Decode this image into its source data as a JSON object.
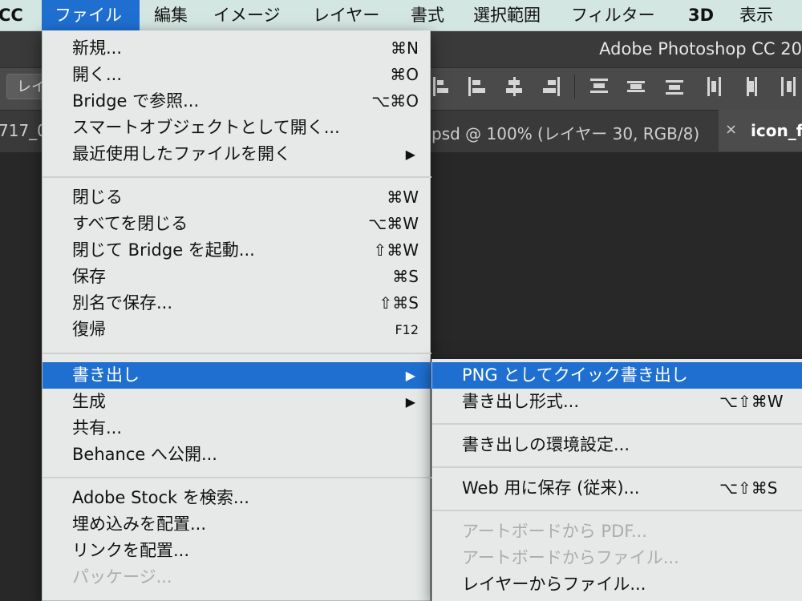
{
  "menubar": {
    "app_name": "CC",
    "items": [
      "ファイル",
      "編集",
      "イメージ",
      "レイヤー",
      "書式",
      "選択範囲",
      "フィルター",
      "3D",
      "表示"
    ]
  },
  "window_title": "Adobe Photoshop CC 20",
  "options_bar": {
    "layer_select_label": "レイヤー"
  },
  "tabs": {
    "left_fragment": "717_0",
    "middle": "psd @ 100% (レイヤー 30, RGB/8)",
    "active": "icon_fo"
  },
  "file_menu": {
    "items": [
      {
        "label": "新規...",
        "shortcut": "⌘N"
      },
      {
        "label": "開く...",
        "shortcut": "⌘O"
      },
      {
        "label": "Bridge で参照...",
        "shortcut": "⌥⌘O"
      },
      {
        "label": "スマートオブジェクトとして開く...",
        "shortcut": ""
      },
      {
        "label": "最近使用したファイルを開く",
        "submenu": true
      },
      {
        "label": "閉じる",
        "shortcut": "⌘W"
      },
      {
        "label": "すべてを閉じる",
        "shortcut": "⌥⌘W"
      },
      {
        "label": "閉じて Bridge を起動...",
        "shortcut": "⇧⌘W"
      },
      {
        "label": "保存",
        "shortcut": "⌘S"
      },
      {
        "label": "別名で保存...",
        "shortcut": "⇧⌘S"
      },
      {
        "label": "復帰",
        "shortcut": "F12"
      },
      {
        "label": "書き出し",
        "submenu": true,
        "highlighted": true
      },
      {
        "label": "生成",
        "submenu": true
      },
      {
        "label": "共有...",
        "shortcut": ""
      },
      {
        "label": "Behance へ公開...",
        "shortcut": ""
      },
      {
        "label": "Adobe Stock を検索...",
        "shortcut": ""
      },
      {
        "label": "埋め込みを配置...",
        "shortcut": ""
      },
      {
        "label": "リンクを配置...",
        "shortcut": ""
      },
      {
        "label": "パッケージ...",
        "disabled": true
      }
    ]
  },
  "export_submenu": {
    "items": [
      {
        "label": "PNG としてクイック書き出し",
        "highlighted": true
      },
      {
        "label": "書き出し形式...",
        "shortcut": "⌥⇧⌘W"
      },
      {
        "label": "書き出しの環境設定...",
        "shortcut": ""
      },
      {
        "label": "Web 用に保存 (従来)...",
        "shortcut": "⌥⇧⌘S"
      },
      {
        "label": "アートボードから PDF...",
        "disabled": true
      },
      {
        "label": "アートボードからファイル...",
        "disabled": true
      },
      {
        "label": "レイヤーからファイル..."
      }
    ]
  },
  "submenu_arrow": "▶",
  "close_glyph": "×",
  "colors": {
    "highlight": "#1f6fd1",
    "menubar": "#d4e6e1",
    "menu_bg": "#e6e9e8",
    "disabled": "#a9adac"
  }
}
